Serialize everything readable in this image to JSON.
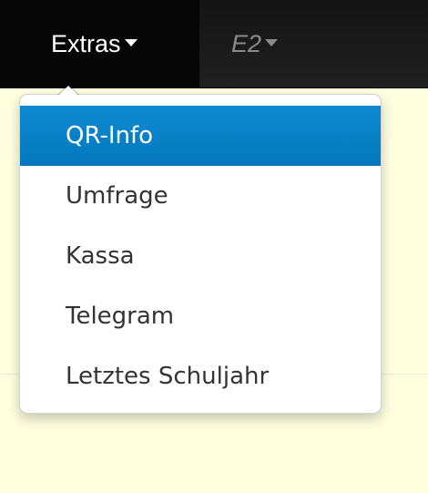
{
  "navbar": {
    "extras_label": "Extras",
    "e2_label": "E2"
  },
  "dropdown": {
    "items": [
      {
        "label": "QR-Info",
        "active": true
      },
      {
        "label": "Umfrage",
        "active": false
      },
      {
        "label": "Kassa",
        "active": false
      },
      {
        "label": "Telegram",
        "active": false
      },
      {
        "label": "Letztes Schuljahr",
        "active": false
      }
    ]
  },
  "colors": {
    "page_background": "#ffffe0",
    "navbar_background": "#1a1a1a",
    "active_item": "#0a82c8",
    "menu_text": "#333333"
  },
  "icons": {
    "extras_caret": "caret-down-icon",
    "e2_caret": "caret-down-icon"
  }
}
